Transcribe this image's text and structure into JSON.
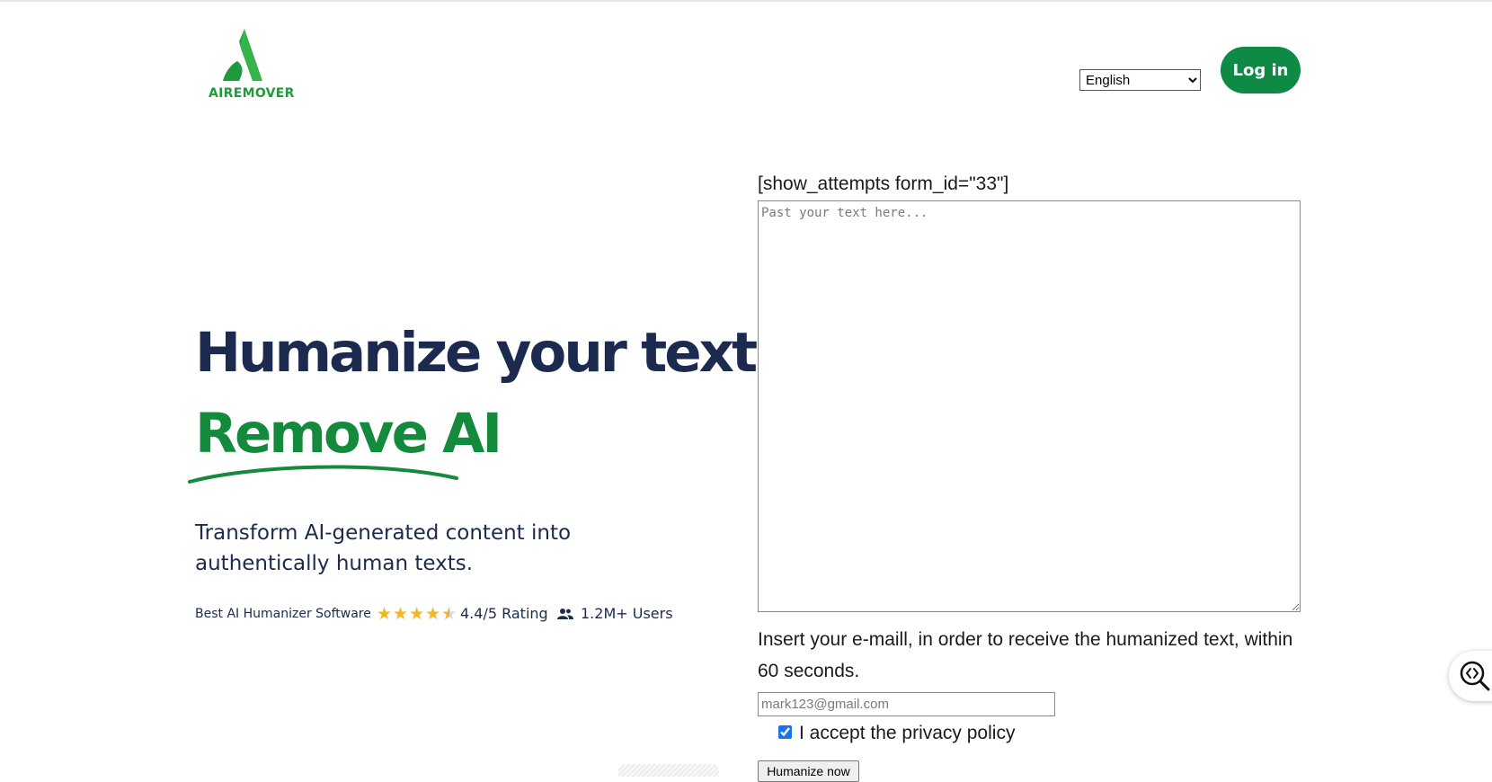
{
  "header": {
    "logo_text": "AIREMOVER",
    "language_selected": "English",
    "login_label": "Log in"
  },
  "hero": {
    "title": "Humanize your texts",
    "subtitle": "Remove AI",
    "description": "Transform AI-generated content into authentically human texts.",
    "badge_software": "Best AI Humanizer Software",
    "rating_text": "4.4/5 Rating",
    "rating_value": 4.4,
    "rating_max": 5,
    "users_text": "1.2M+ Users"
  },
  "form": {
    "shortcode_text": "[show_attempts form_id=\"33\"]",
    "textarea_placeholder": "Past your text here...",
    "email_instruction": "Insert your e-maill, in order to receive the humanized text, within 60 seconds.",
    "email_placeholder": "mark123@gmail.com",
    "privacy_label": "I accept the privacy policy",
    "privacy_checked": true,
    "submit_label": "Humanize now"
  },
  "colors": {
    "brand_green": "#0e8a45",
    "heading_navy": "#1b2a4e",
    "accent_green": "#138a3c",
    "star_gold": "#f0b623"
  },
  "icons": {
    "logo": "airemover-logo-icon",
    "stars": "star-icon",
    "users": "users-icon",
    "widget": "code-search-icon"
  }
}
